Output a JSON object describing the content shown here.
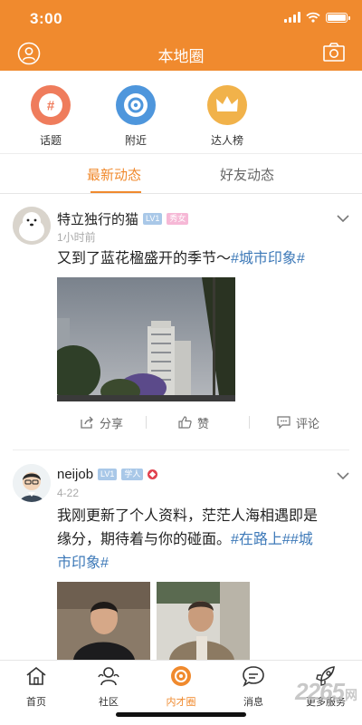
{
  "status_bar": {
    "time": "3:00"
  },
  "header": {
    "title": "本地圈",
    "left_icon": "user-circle-icon",
    "right_icon": "camera-icon"
  },
  "quick_actions": [
    {
      "label": "话题",
      "icon": "hashtag-icon",
      "color": "#ef7c5c"
    },
    {
      "label": "附近",
      "icon": "location-icon",
      "color": "#4e96dc"
    },
    {
      "label": "达人榜",
      "icon": "crown-icon",
      "color": "#f1b24a"
    }
  ],
  "tabs": [
    {
      "label": "最新动态",
      "active": true
    },
    {
      "label": "好友动态",
      "active": false
    }
  ],
  "posts": [
    {
      "author": "特立独行的猫",
      "level": "LV1",
      "tag_badge": "秀女",
      "time": "1小时前",
      "text": "又到了蓝花楹盛开的季节～",
      "hashtags": [
        "#城市印象#"
      ],
      "actions": {
        "share": "分享",
        "like": "赞",
        "comment": "评论"
      }
    },
    {
      "author": "neijob",
      "level": "LV1",
      "tag_badge": "学人",
      "time": "4-22",
      "text_line1": "我刚更新了个人资料，茫茫人海相遇即是",
      "text_line2_prefix": "缘分，期待着与你的碰面。",
      "hashtag_a": "#在路上#",
      "hashtag_b": "#城",
      "text_line3": "市印象#"
    }
  ],
  "bottom_nav": [
    {
      "label": "首页",
      "icon": "home-icon",
      "active": false
    },
    {
      "label": "社区",
      "icon": "community-icon",
      "active": false
    },
    {
      "label": "内才圈",
      "icon": "circle-icon",
      "active": true
    },
    {
      "label": "消息",
      "icon": "message-icon",
      "active": false
    },
    {
      "label": "更多服务",
      "icon": "rocket-icon",
      "active": false
    }
  ],
  "watermark": {
    "main": "2265",
    "suffix": "网"
  },
  "colors": {
    "brand": "#f08a2e",
    "hashtag": "#3d79b8"
  }
}
